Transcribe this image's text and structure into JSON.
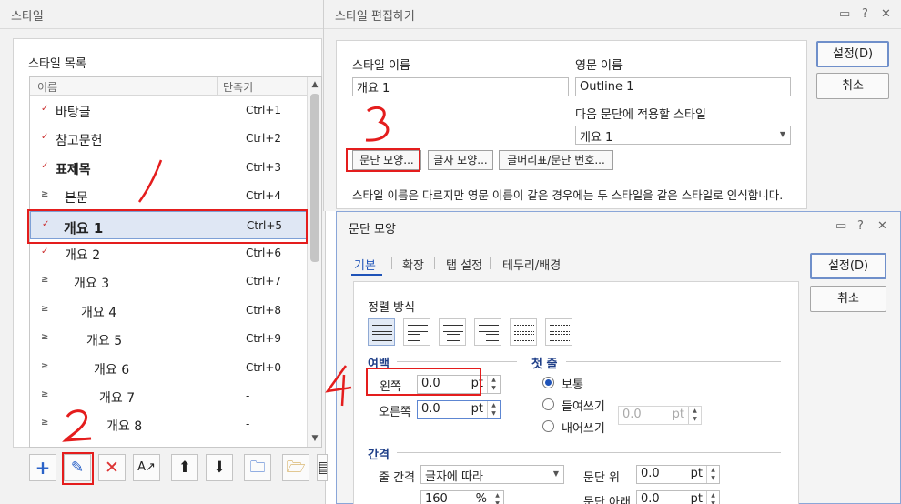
{
  "style_dialog": {
    "title": "스타일",
    "list_label": "스타일 목록",
    "columns": {
      "name": "이름",
      "shortcut": "단축키"
    },
    "items": [
      {
        "name": "바탕글",
        "shortcut": "Ctrl+1",
        "icon": "char-style-icon"
      },
      {
        "name": "참고문헌",
        "shortcut": "Ctrl+2",
        "icon": "char-style-icon"
      },
      {
        "name": "표제목",
        "shortcut": "Ctrl+3",
        "icon": "char-style-icon"
      },
      {
        "name": "본문",
        "shortcut": "Ctrl+4",
        "icon": "para-style-icon"
      },
      {
        "name": "개요 1",
        "shortcut": "Ctrl+5",
        "icon": "char-style-icon"
      },
      {
        "name": "개요 2",
        "shortcut": "Ctrl+6",
        "icon": "char-style-icon"
      },
      {
        "name": "개요 3",
        "shortcut": "Ctrl+7",
        "icon": "para-style-icon"
      },
      {
        "name": "개요 4",
        "shortcut": "Ctrl+8",
        "icon": "para-style-icon"
      },
      {
        "name": "개요 5",
        "shortcut": "Ctrl+9",
        "icon": "para-style-icon"
      },
      {
        "name": "개요 6",
        "shortcut": "Ctrl+0",
        "icon": "para-style-icon"
      },
      {
        "name": "개요 7",
        "shortcut": "-",
        "icon": "para-style-icon"
      },
      {
        "name": "개요 8",
        "shortcut": "-",
        "icon": "para-style-icon"
      }
    ],
    "selected_index": 4,
    "annotations": {
      "one": "1",
      "two": "2"
    }
  },
  "edit_dialog": {
    "title": "스타일 편집하기",
    "style_name_label": "스타일 이름",
    "style_name_value": "개요 1",
    "english_name_label": "영문 이름",
    "english_name_value": "Outline 1",
    "next_style_label": "다음 문단에 적용할 스타일",
    "next_style_value": "개요 1",
    "buttons": {
      "paragraph": "문단 모양...",
      "character": "글자 모양...",
      "bullet": "글머리표/문단 번호...",
      "ok": "설정(D)",
      "cancel": "취소"
    },
    "note": "스타일 이름은 다르지만 영문 이름이 같은 경우에는 두 스타일을 같은 스타일로 인식합니다.",
    "annotation": "3"
  },
  "para_dialog": {
    "title": "문단 모양",
    "tabs": [
      "기본",
      "확장",
      "탭 설정",
      "테두리/배경"
    ],
    "alignment_label": "정렬 방식",
    "margin_group": "여백",
    "left_label": "왼쪽",
    "left_value": "0.0",
    "right_label": "오른쪽",
    "right_value": "0.0",
    "unit": "pt",
    "first_line_group": "첫 줄",
    "first_line_options": [
      "보통",
      "들여쓰기",
      "내어쓰기"
    ],
    "first_line_value": "0.0",
    "spacing_group": "간격",
    "line_spacing_label": "줄 간격",
    "line_spacing_type": "글자에 따라",
    "line_spacing_value": "160",
    "line_spacing_unit": "%",
    "para_above_label": "문단 위",
    "para_above_value": "0.0",
    "para_below_label": "문단 아래",
    "para_below_value": "0.0",
    "buttons": {
      "ok": "설정(D)",
      "cancel": "취소"
    },
    "annotation": "4"
  }
}
